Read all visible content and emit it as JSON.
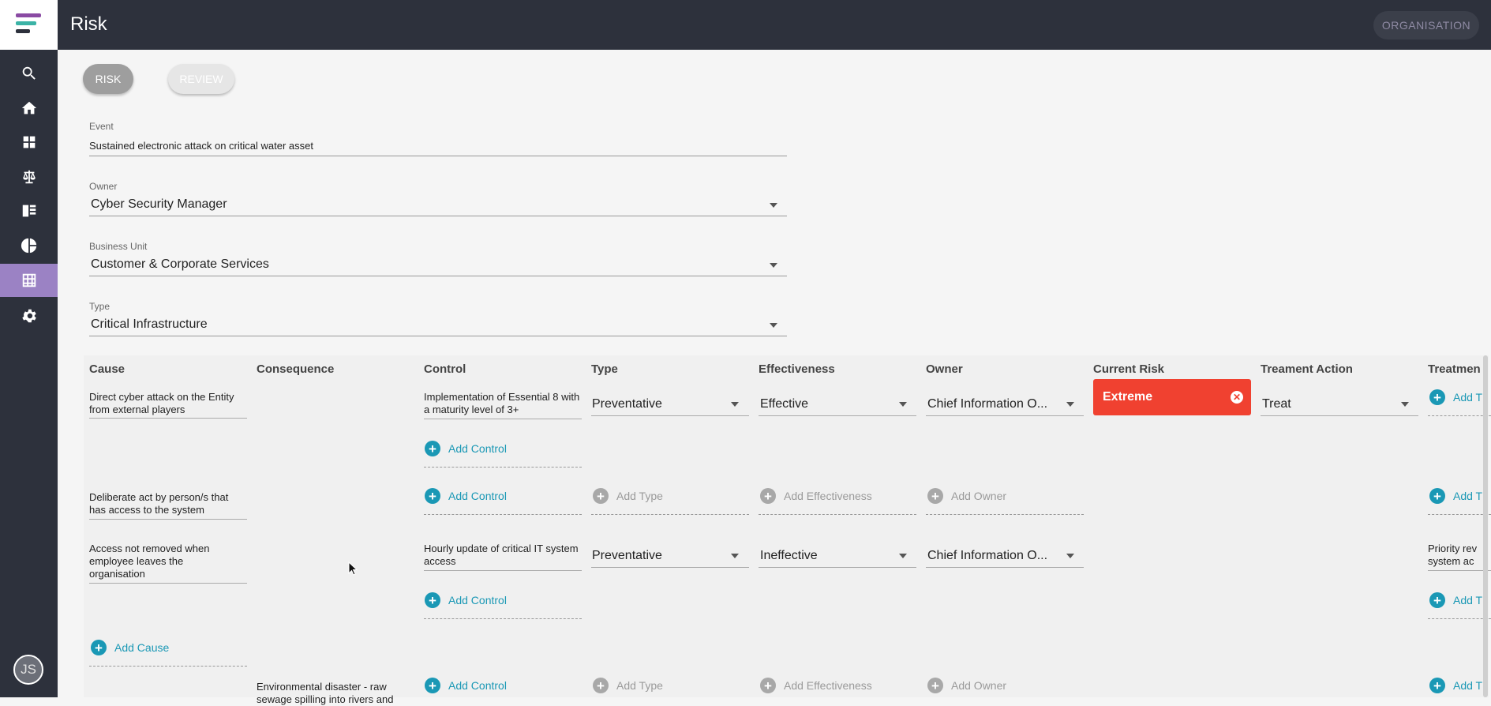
{
  "header": {
    "title": "Risk",
    "org_button": "ORGANISATION"
  },
  "user": {
    "initials": "JS"
  },
  "tabs": {
    "risk": "RISK",
    "review": "REVIEW"
  },
  "form": {
    "event_label": "Event",
    "event_value": "Sustained electronic attack on critical water asset",
    "owner_label": "Owner",
    "owner_value": "Cyber Security Manager",
    "bu_label": "Business Unit",
    "bu_value": "Customer & Corporate Services",
    "type_label": "Type",
    "type_value": "Critical Infrastructure"
  },
  "columns": {
    "cause": "Cause",
    "consequence": "Consequence",
    "control": "Control",
    "type": "Type",
    "effectiveness": "Effectiveness",
    "owner": "Owner",
    "current_risk": "Current Risk",
    "treatment_action": "Treament Action",
    "treatment": "Treatmen"
  },
  "rows": {
    "r1": {
      "cause": "Direct cyber attack on the Entity from external players",
      "control": "Implementation of Essential 8 with a maturity level of 3+",
      "type": "Preventative",
      "effectiveness": "Effective",
      "owner": "Chief Information O...",
      "current_risk": "Extreme",
      "treatment_action": "Treat",
      "treatment_add": "Add T"
    },
    "r2": {
      "cause": "Deliberate act by person/s that has access to the system",
      "add_control": "Add Control",
      "add_type": "Add Type",
      "add_effectiveness": "Add Effectiveness",
      "add_owner": "Add Owner",
      "treatment_add": "Add T"
    },
    "r3": {
      "cause": "Access not removed when employee leaves the organisation",
      "control": "Hourly update of critical IT system access",
      "type": "Preventative",
      "effectiveness": "Ineffective",
      "owner": "Chief Information O...",
      "treatment": "Priority rev system ac",
      "treatment_add": "Add T"
    },
    "r4": {
      "consequence": "Environmental disaster - raw sewage spilling into rivers and",
      "add_control": "Add Control",
      "add_type": "Add Type",
      "add_effectiveness": "Add Effectiveness",
      "add_owner": "Add Owner",
      "treatment_add": "Add T"
    }
  },
  "actions": {
    "add_control": "Add Control",
    "add_cause": "Add Cause"
  },
  "colors": {
    "accent": "#1a98b5",
    "extreme": "#f04130",
    "nav_active": "#9b82c4",
    "header": "#2d313c"
  }
}
